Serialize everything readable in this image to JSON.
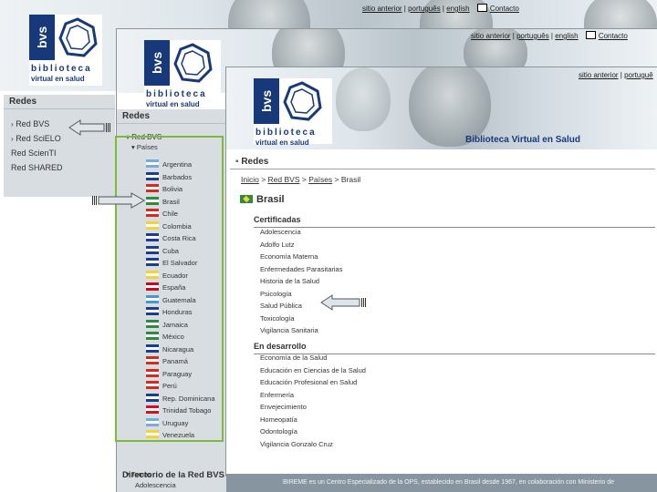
{
  "top_links": {
    "previous_site": "sitio anterior",
    "portuguese": "português",
    "english": "english",
    "contact": "Contacto"
  },
  "top_links_w2": {
    "previous_site": "sitio anterior",
    "portuguese": "português",
    "english": "english",
    "contact": "Contacto"
  },
  "top_links_w3": {
    "previous_site": "sitio anterior",
    "portuguese": "portuguê"
  },
  "logo": {
    "mark": "bvs",
    "line1": "biblioteca",
    "line2": "virtual en salud"
  },
  "site_title": "Biblioteca Virtual en Salud",
  "sidebar1": {
    "header": "Redes",
    "items": [
      "Red BVS",
      "Red SciELO",
      "Red ScienTI",
      "Red SHARED"
    ]
  },
  "sidebar2": {
    "header": "Redes",
    "subheader": "Red BVS",
    "group": "Países",
    "countries": [
      "Argentina",
      "Barbados",
      "Bolivia",
      "Brasil",
      "Chile",
      "Colombia",
      "Costa Rica",
      "Cuba",
      "El Salvador",
      "Ecuador",
      "España",
      "Guatemala",
      "Honduras",
      "Jamaica",
      "México",
      "Nicaragua",
      "Panamá",
      "Paraguay",
      "Perú",
      "Rep. Dominicana",
      "Trinidad Tobago",
      "Uruguay",
      "Venezuela"
    ],
    "group2": "Temas",
    "group2_item": "Adolescencia",
    "footer": "Directorio de la Red BVS"
  },
  "page3": {
    "section_header": "Redes",
    "breadcrumb": {
      "home": "Inicio",
      "net": "Red BVS",
      "countries": "Países",
      "current": "Brasil"
    },
    "country_title": "Brasil",
    "certified_title": "Certificadas",
    "certified": [
      "Adolescencia",
      "Adolfo Lutz",
      "Economía Materna",
      "Enfermedades Parasitarias",
      "Historia de la Salud",
      "Psicología",
      "Salud Pública",
      "Toxicología",
      "Vigilancia Sanitaria"
    ],
    "dev_title": "En desarrollo",
    "dev": [
      "Economía de la Salud",
      "Educación en Ciencias de la Salud",
      "Educación Profesional en Salud",
      "Enfermería",
      "Envejecimiento",
      "Homeopatía",
      "Odontología",
      "Vigilancia Gonzalo Cruz"
    ],
    "footer": "BIREME es un Centro Especializado de la OPS, establecido en Brasil desde 1967, en colaboración con Ministerio de"
  },
  "colors": {
    "brand": "#17397a",
    "highlight": "#7dba3a",
    "footer": "#8795a0"
  }
}
